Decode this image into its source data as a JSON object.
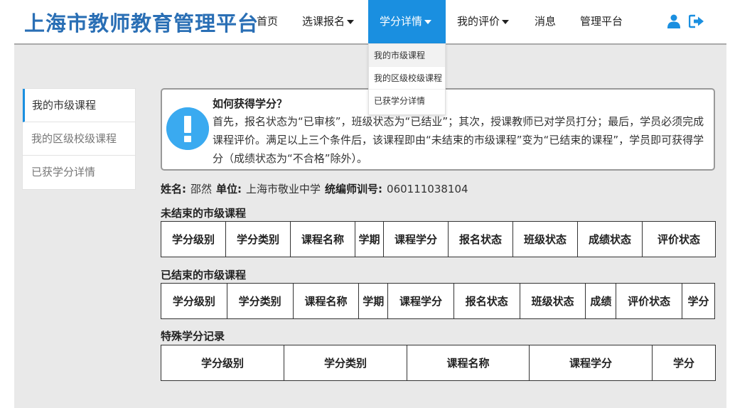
{
  "header": {
    "logo": "上海市教师教育管理平台",
    "nav": {
      "home": "首页",
      "enroll": "选课报名",
      "credits": "学分详情",
      "evaluation": "我的评价",
      "messages": "消息",
      "admin": "管理平台"
    },
    "icons": {
      "user": "user-icon",
      "logout": "sign-out-icon"
    },
    "active_color": "#1a8fe0"
  },
  "dropdown": {
    "items": [
      "我的市级课程",
      "我的区级校级课程",
      "已获学分详情"
    ]
  },
  "sidebar": {
    "items": [
      "我的市级课程",
      "我的区级校级课程",
      "已获学分详情"
    ]
  },
  "notice": {
    "icon": "exclamation-icon",
    "title": "如何获得学分？",
    "body": "首先，报名状态为“已审核”，班级状态为“已结业”；其次，授课教师已对学员打分；最后，学员必须完成课程评价。满足以上三个条件后，该课程即由“未结束的市级课程”变为“已结束的课程”，学员即可获得学分（成绩状态为“不合格”除外）。"
  },
  "info": {
    "name_label": "姓名:",
    "name": "邵然",
    "unit_label": "单位:",
    "unit": "上海市敬业中学",
    "id_label": "统编师训号:",
    "id": "060111038104"
  },
  "tables": {
    "unfinished": {
      "title": "未结束的市级课程",
      "headers": [
        "学分级别",
        "学分类别",
        "课程名称",
        "学期",
        "课程学分",
        "报名状态",
        "班级状态",
        "成绩状态",
        "评价状态"
      ]
    },
    "finished": {
      "title": "已结束的市级课程",
      "headers": [
        "学分级别",
        "学分类别",
        "课程名称",
        "学期",
        "课程学分",
        "报名状态",
        "班级状态",
        "成绩",
        "评价状态",
        "学分"
      ]
    },
    "special": {
      "title": "特殊学分记录",
      "headers": [
        "学分级别",
        "学分类别",
        "课程名称",
        "课程学分",
        "学分"
      ]
    }
  }
}
